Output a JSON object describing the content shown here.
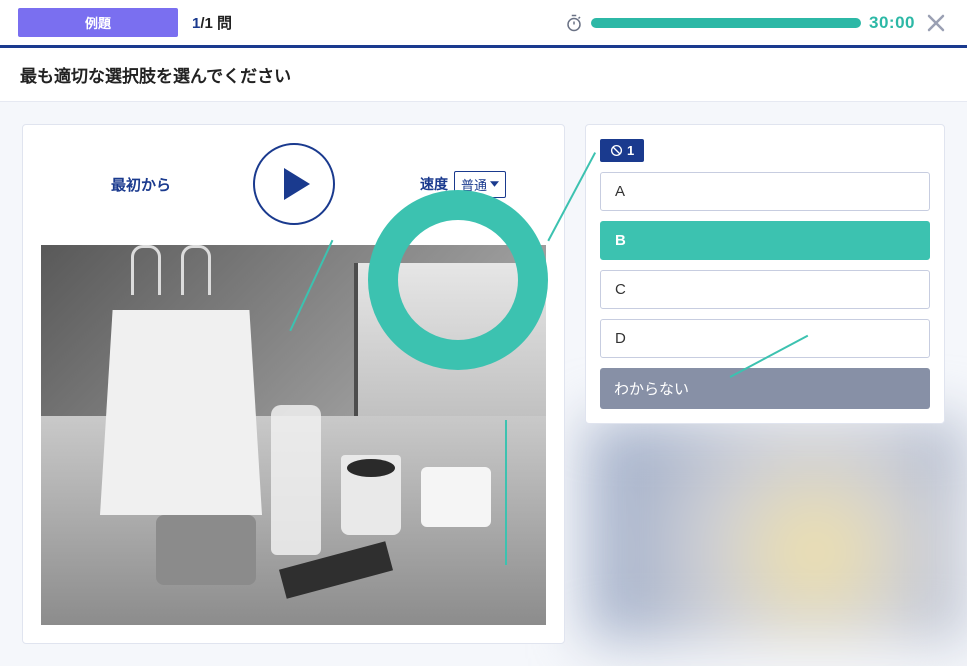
{
  "topbar": {
    "example_label": "例題",
    "current_q": "1",
    "total_q": "1",
    "counter_suffix": " 問",
    "time_remaining": "30:00"
  },
  "instruction": "最も適切な選択肢を選んでください",
  "audio": {
    "restart_label": "最初から",
    "speed_label": "速度",
    "speed_value": "普通"
  },
  "question": {
    "chip_number": "1",
    "options": [
      {
        "label": "A",
        "selected": false
      },
      {
        "label": "B",
        "selected": true
      },
      {
        "label": "C",
        "selected": false
      },
      {
        "label": "D",
        "selected": false
      }
    ],
    "dont_know_label": "わからない"
  },
  "icons": {
    "stopwatch": "stopwatch-icon",
    "close": "close-icon",
    "no_audio": "no-audio-icon",
    "dropdown": "chevron-down-icon",
    "play": "play-icon"
  }
}
